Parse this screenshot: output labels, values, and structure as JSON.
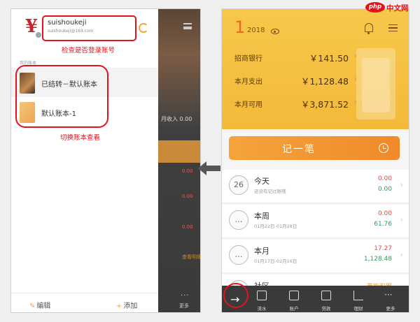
{
  "left": {
    "username": "suishoukeji",
    "email": "suishoukeji@163.com",
    "annotation_check": "检查是否登录账号",
    "section_title": "我的账本",
    "books": [
      {
        "name": "已结转－默认账本"
      },
      {
        "name": "默认账本-1"
      }
    ],
    "annotation_switch": "切换账本查看",
    "footer": {
      "edit": "编辑",
      "add": "添加",
      "edit_icon": "pencil-icon",
      "add_icon": "plus-icon"
    },
    "background": {
      "income_text": "月收入 0.00",
      "values": [
        "0.00",
        "0.00",
        "0.00",
        "查看明细"
      ],
      "more_label": "更多"
    }
  },
  "right": {
    "month": "1",
    "year": "2018",
    "summary": [
      {
        "label": "招商银行",
        "value": "￥141.50"
      },
      {
        "label": "本月支出",
        "value": "￥1,128.48"
      },
      {
        "label": "本月可用",
        "value": "￥3,871.52"
      }
    ],
    "record_button": "记一笔",
    "periods": [
      {
        "icon": "26",
        "title": "今天",
        "sub": "还没有记过账哦",
        "expense": "0.00",
        "income": "0.00"
      },
      {
        "icon": "…",
        "title": "本周",
        "sub": "01月22日-01月28日",
        "expense": "0.00",
        "income": "61.76"
      },
      {
        "icon": "…",
        "title": "本月",
        "sub": "01月17日-02月16日",
        "expense": "17.27",
        "income": "1,128.48"
      },
      {
        "icon": "…",
        "title": "社区",
        "sub": "",
        "expense": "",
        "income": "若能积累"
      }
    ],
    "tabs": [
      {
        "label": "流水"
      },
      {
        "label": "账户"
      },
      {
        "label": "贷款"
      },
      {
        "label": "理财"
      },
      {
        "label": "更多"
      }
    ]
  },
  "watermark": {
    "php": "php",
    "cn": "中文网"
  },
  "colors": {
    "annotation_red": "#e3131b",
    "brand_orange": "#f0892a",
    "header_yellow": "#f6c84a",
    "income_green": "#2d9b5c",
    "expense_red": "#e34a3c"
  }
}
